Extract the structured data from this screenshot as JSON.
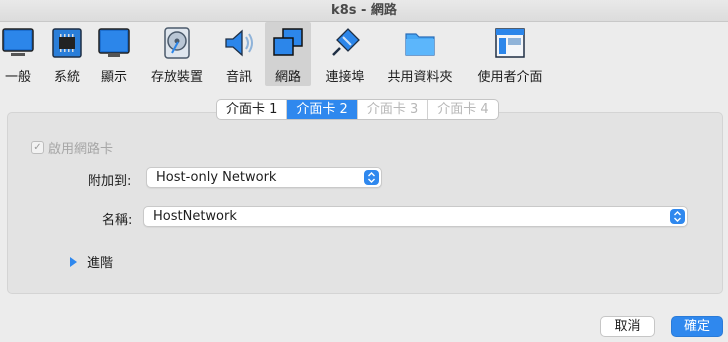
{
  "window": {
    "title": "k8s - 網路"
  },
  "toolbar": {
    "items": [
      {
        "label": "一般",
        "icon": "general-icon"
      },
      {
        "label": "系統",
        "icon": "chip-icon"
      },
      {
        "label": "顯示",
        "icon": "monitor-icon"
      },
      {
        "label": "存放裝置",
        "icon": "disk-icon"
      },
      {
        "label": "音訊",
        "icon": "speaker-icon"
      },
      {
        "label": "網路",
        "icon": "network-icon",
        "active": true
      },
      {
        "label": "連接埠",
        "icon": "plug-icon"
      },
      {
        "label": "共用資料夾",
        "icon": "folder-icon"
      },
      {
        "label": "使用者介面",
        "icon": "window-icon"
      }
    ]
  },
  "adapter_tabs": [
    {
      "label": "介面卡 1",
      "state": "normal"
    },
    {
      "label": "介面卡 2",
      "state": "selected"
    },
    {
      "label": "介面卡 3",
      "state": "disabled"
    },
    {
      "label": "介面卡 4",
      "state": "disabled"
    }
  ],
  "form": {
    "enable_label": "啟用網路卡",
    "enable_checked": true,
    "attached_label": "附加到:",
    "attached_value": "Host-only Network",
    "name_label": "名稱:",
    "name_value": "HostNetwork",
    "advanced_label": "進階"
  },
  "buttons": {
    "cancel": "取消",
    "ok": "確定"
  },
  "colors": {
    "accent": "#2f88ee",
    "active_tab_bg": "#d2d2d2"
  }
}
